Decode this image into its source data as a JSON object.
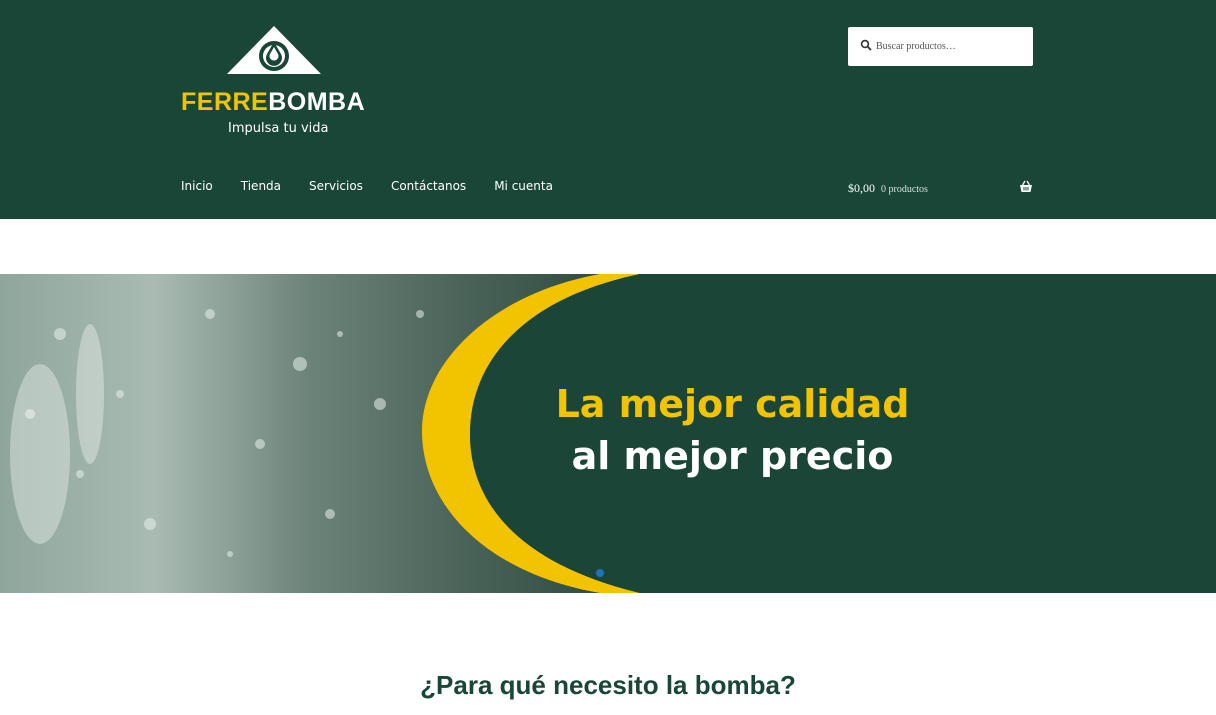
{
  "brand": {
    "name_part1": "FERRE",
    "name_part2": "BOMBA",
    "tagline": "Impulsa tu vida"
  },
  "search": {
    "placeholder": "Buscar productos…",
    "icon": "search-icon"
  },
  "nav": {
    "items": [
      {
        "label": "Inicio"
      },
      {
        "label": "Tienda"
      },
      {
        "label": "Servicios"
      },
      {
        "label": "Contáctanos"
      },
      {
        "label": "Mi cuenta"
      }
    ]
  },
  "cart": {
    "amount": "$0,00",
    "count": "0 productos",
    "icon": "basket-icon"
  },
  "hero": {
    "line1": "La mejor calidad",
    "line2": "al mejor precio",
    "active_slide": 1
  },
  "section": {
    "title": "¿Para qué necesito la bomba?"
  },
  "colors": {
    "header_bg": "#194637",
    "accent_yellow": "#f2c400",
    "slider_dot": "#1e73be"
  }
}
